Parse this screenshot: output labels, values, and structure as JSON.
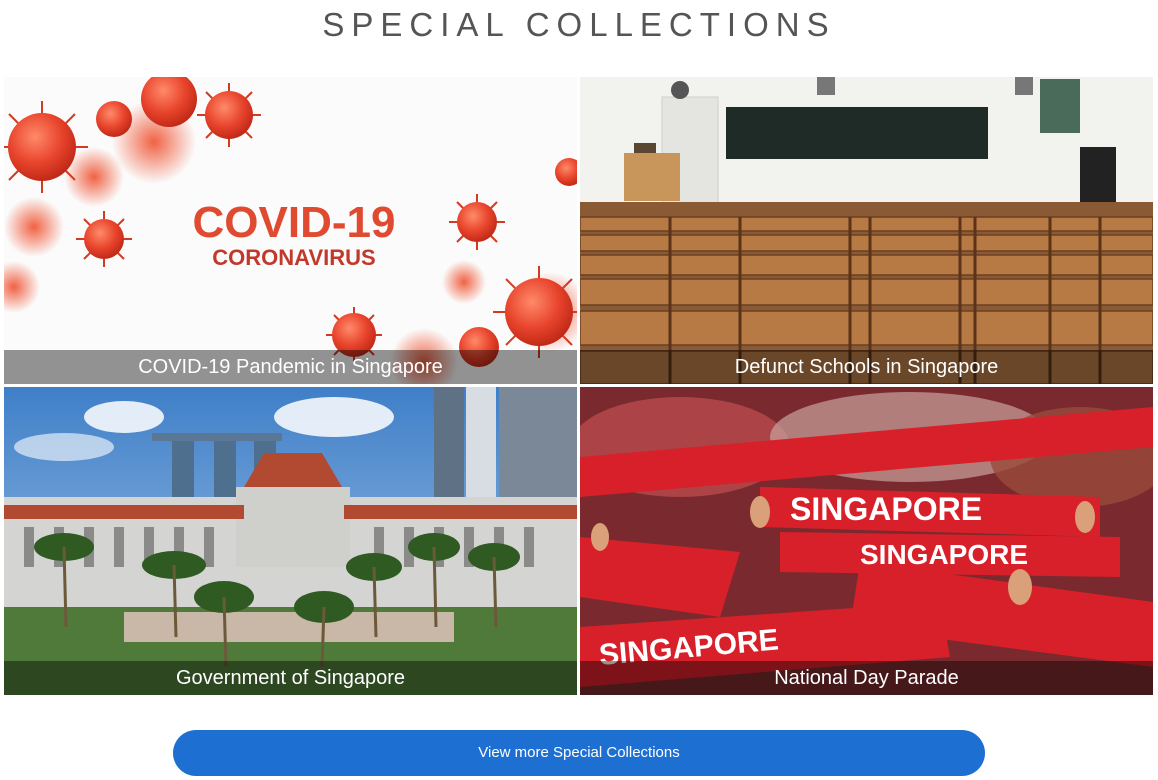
{
  "section": {
    "title": "SPECIAL COLLECTIONS"
  },
  "collections": [
    {
      "caption": "COVID-19 Pandemic in Singapore",
      "image_text_line1": "COVID-19",
      "image_text_line2": "CORONAVIRUS"
    },
    {
      "caption": "Defunct Schools in Singapore"
    },
    {
      "caption": "Government of Singapore"
    },
    {
      "caption": "National Day Parade",
      "image_text": "SINGAPORE"
    }
  ],
  "view_more_label": "View more Special Collections",
  "colors": {
    "button": "#1e6fd2",
    "title": "#555555",
    "virus": "#e8442c",
    "scarf": "#d8202a"
  }
}
